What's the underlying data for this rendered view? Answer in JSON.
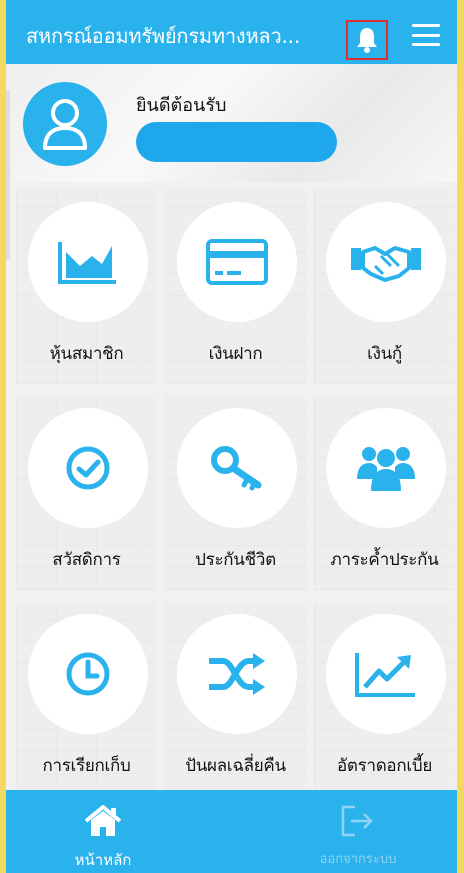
{
  "header": {
    "title": "สหกรณ์ออมทรัพย์กรมทางหลว...",
    "bell_icon": "bell-icon",
    "menu_icon": "hamburger-menu-icon"
  },
  "welcome": {
    "greeting": "ยินดีต้อนรับ",
    "avatar_icon": "user-icon"
  },
  "menu": [
    {
      "label": "หุ้นสมาชิก",
      "icon": "area-chart-icon"
    },
    {
      "label": "เงินฝาก",
      "icon": "credit-card-icon"
    },
    {
      "label": "เงินกู้",
      "icon": "handshake-icon"
    },
    {
      "label": "สวัสดิการ",
      "icon": "check-circle-icon"
    },
    {
      "label": "ประกันชีวิต",
      "icon": "key-icon"
    },
    {
      "label": "ภาระค้ำประกัน",
      "icon": "users-group-icon"
    },
    {
      "label": "การเรียกเก็บ",
      "icon": "clock-icon"
    },
    {
      "label": "ปันผลเฉลี่ยคืน",
      "icon": "shuffle-icon"
    },
    {
      "label": "อัตราดอกเบี้ย",
      "icon": "line-chart-icon"
    }
  ],
  "bottom_nav": {
    "home_label": "หน้าหลัก",
    "logout_label": "ออกจากระบบ"
  },
  "colors": {
    "primary": "#2ab2ec",
    "frame": "#f5d862",
    "highlight": "#e0302e",
    "inactive_nav": "#8fd3f5"
  }
}
